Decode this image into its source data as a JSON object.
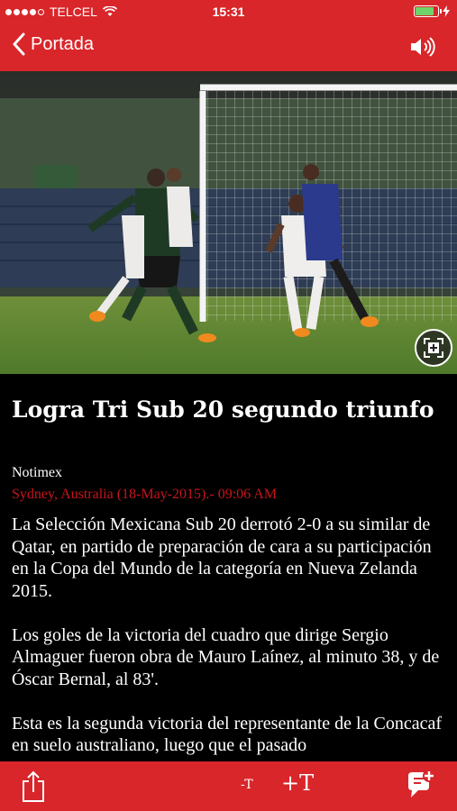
{
  "status_bar": {
    "carrier": "TELCEL",
    "time": "15:31",
    "signal_bars_filled": 4,
    "signal_bars_total": 5,
    "battery_level": 0.85,
    "battery_color": "#6fd36b"
  },
  "nav": {
    "back_label": "Portada",
    "back_icon": "chevron-left-icon",
    "audio_icon": "speaker-icon",
    "bar_color": "#d9262a"
  },
  "photo": {
    "expand_icon": "expand-icon"
  },
  "article": {
    "headline": "Logra Tri Sub 20 segundo triunfo",
    "source": "Notimex",
    "dateline": "Sydney, Australia (18-May-2015).- 09:06 AM",
    "dateline_color": "#c8141c",
    "paragraphs": [
      "La Selección Mexicana Sub 20 derrotó 2-0 a su similar de Qatar, en partido de preparación de cara a su participación en la Copa del Mundo de la categoría en Nueva Zelanda 2015.",
      "Los goles de la victoria del cuadro que dirige Sergio Almaguer fueron obra de Mauro Laínez, al minuto 38, y de Óscar Bernal, al 83'.",
      "Esta es la segunda victoria del representante de la Concacaf en suelo australiano, luego que el pasado"
    ]
  },
  "toolbar": {
    "share_icon": "share-icon",
    "font_decrease_label": "-T",
    "font_increase_label": "+T",
    "comment_icon": "comment-add-icon"
  }
}
